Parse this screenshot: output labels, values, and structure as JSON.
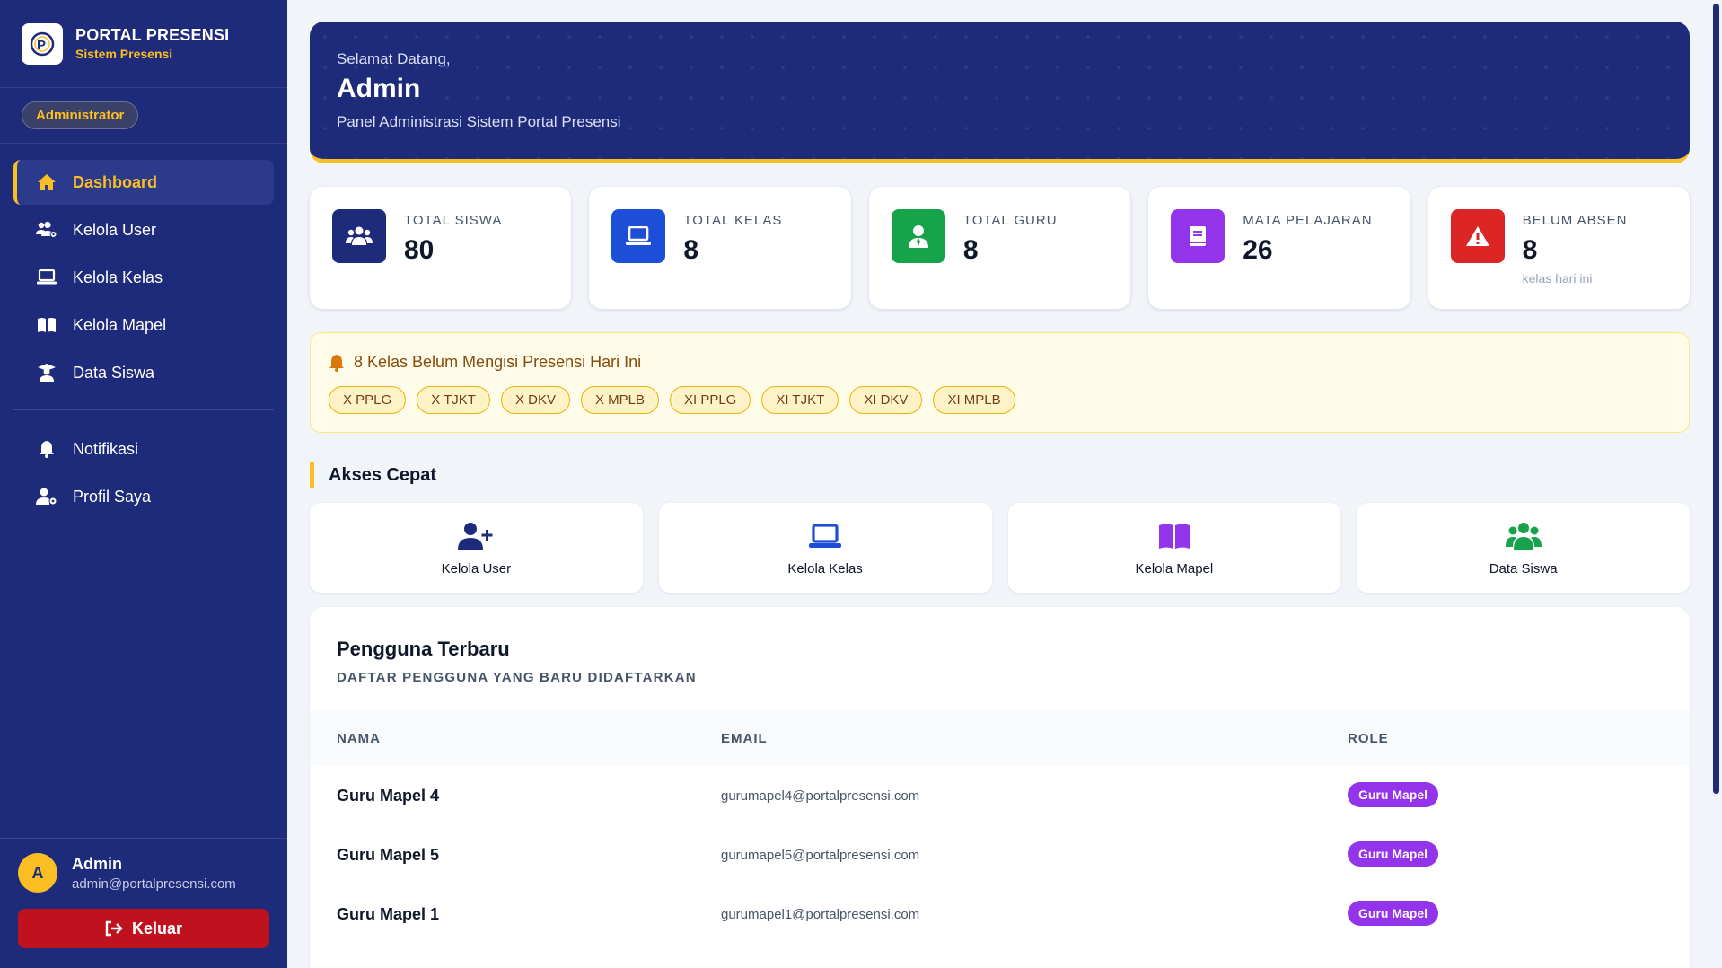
{
  "brand": {
    "title": "PORTAL PRESENSI",
    "subtitle": "Sistem Presensi"
  },
  "role_badge": "Administrator",
  "nav": {
    "items": [
      {
        "label": "Dashboard",
        "icon": "home-icon"
      },
      {
        "label": "Kelola User",
        "icon": "users-cog-icon"
      },
      {
        "label": "Kelola Kelas",
        "icon": "laptop-icon"
      },
      {
        "label": "Kelola Mapel",
        "icon": "book-open-icon"
      },
      {
        "label": "Data Siswa",
        "icon": "graduate-icon"
      },
      {
        "label": "Notifikasi",
        "icon": "bell-icon"
      },
      {
        "label": "Profil Saya",
        "icon": "user-cog-icon"
      }
    ],
    "active": "Dashboard"
  },
  "user": {
    "initial": "A",
    "name": "Admin",
    "email": "admin@portalpresensi.com",
    "logout_label": "Keluar"
  },
  "hero": {
    "greeting": "Selamat Datang,",
    "name": "Admin",
    "description": "Panel Administrasi Sistem Portal Presensi"
  },
  "stats": [
    {
      "label": "TOTAL SISWA",
      "value": "80",
      "color": "#1e2a7a",
      "icon": "users-icon"
    },
    {
      "label": "TOTAL KELAS",
      "value": "8",
      "color": "#1d4ed8",
      "icon": "laptop-icon"
    },
    {
      "label": "TOTAL GURU",
      "value": "8",
      "color": "#16a34a",
      "icon": "teacher-icon"
    },
    {
      "label": "MATA PELAJARAN",
      "value": "26",
      "color": "#9333ea",
      "icon": "book-icon"
    },
    {
      "label": "BELUM ABSEN",
      "value": "8",
      "note": "kelas hari ini",
      "color": "#dc2626",
      "icon": "warning-icon"
    }
  ],
  "alert": {
    "title": "8 Kelas Belum Mengisi Presensi Hari Ini",
    "classes": [
      "X PPLG",
      "X TJKT",
      "X DKV",
      "X MPLB",
      "XI PPLG",
      "XI TJKT",
      "XI DKV",
      "XI MPLB"
    ]
  },
  "quick_access": {
    "title": "Akses Cepat",
    "items": [
      {
        "label": "Kelola User",
        "icon": "user-plus-icon",
        "color": "#1e2a7a"
      },
      {
        "label": "Kelola Kelas",
        "icon": "laptop-icon",
        "color": "#1d4ed8"
      },
      {
        "label": "Kelola Mapel",
        "icon": "book-open-icon",
        "color": "#9333ea"
      },
      {
        "label": "Data Siswa",
        "icon": "users-icon",
        "color": "#16a34a"
      }
    ]
  },
  "recent_users": {
    "title": "Pengguna Terbaru",
    "subtitle": "DAFTAR PENGGUNA YANG BARU DIDAFTARKAN",
    "columns": [
      "NAMA",
      "EMAIL",
      "ROLE"
    ],
    "rows": [
      {
        "name": "Guru Mapel 4",
        "email": "gurumapel4@portalpresensi.com",
        "role": "Guru Mapel"
      },
      {
        "name": "Guru Mapel 5",
        "email": "gurumapel5@portalpresensi.com",
        "role": "Guru Mapel"
      },
      {
        "name": "Guru Mapel 1",
        "email": "gurumapel1@portalpresensi.com",
        "role": "Guru Mapel"
      }
    ]
  }
}
